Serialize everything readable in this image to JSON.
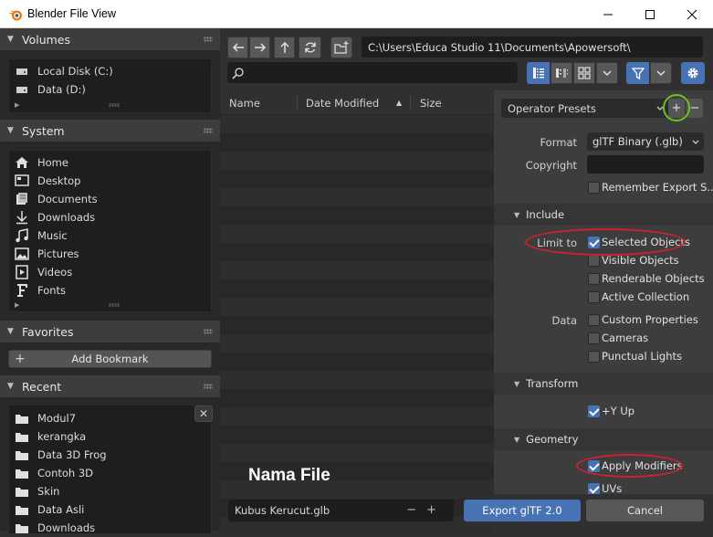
{
  "window": {
    "title": "Blender File View"
  },
  "sidebar": {
    "volumes": {
      "title": "Volumes",
      "items": [
        {
          "label": "Local Disk (C:)"
        },
        {
          "label": "Data (D:)"
        }
      ]
    },
    "system": {
      "title": "System",
      "items": [
        {
          "label": "Home",
          "icon": "home-icon"
        },
        {
          "label": "Desktop",
          "icon": "desktop-icon"
        },
        {
          "label": "Documents",
          "icon": "documents-icon"
        },
        {
          "label": "Downloads",
          "icon": "downloads-icon"
        },
        {
          "label": "Music",
          "icon": "music-icon"
        },
        {
          "label": "Pictures",
          "icon": "pictures-icon"
        },
        {
          "label": "Videos",
          "icon": "videos-icon"
        },
        {
          "label": "Fonts",
          "icon": "fonts-icon"
        }
      ]
    },
    "favorites": {
      "title": "Favorites",
      "add_bookmark": "Add Bookmark"
    },
    "recent": {
      "title": "Recent",
      "items": [
        {
          "label": "Modul7"
        },
        {
          "label": "kerangka"
        },
        {
          "label": "Data 3D Frog"
        },
        {
          "label": "Contoh 3D"
        },
        {
          "label": "Skin"
        },
        {
          "label": "Data Asli"
        },
        {
          "label": "Downloads"
        }
      ]
    }
  },
  "toolbar": {
    "path": "C:\\Users\\Educa Studio 11\\Documents\\Apowersoft\\",
    "search_value": ""
  },
  "filelist": {
    "col_name": "Name",
    "col_date": "Date Modified",
    "col_size": "Size",
    "sort_indicator": "▲"
  },
  "annotation": {
    "label": "Nama File"
  },
  "bottom": {
    "filename": "Kubus Kerucut.glb",
    "export_label": "Export glTF 2.0",
    "cancel_label": "Cancel"
  },
  "settings": {
    "operator_presets": "Operator Presets",
    "format_label": "Format",
    "format_value": "glTF Binary (.glb)",
    "copyright_label": "Copyright",
    "copyright_value": "",
    "remember_export": "Remember Export S...",
    "include": {
      "title": "Include",
      "limit_to_label": "Limit to",
      "data_label": "Data",
      "options": [
        {
          "label": "Selected Objects",
          "checked": true
        },
        {
          "label": "Visible Objects",
          "checked": false
        },
        {
          "label": "Renderable Objects",
          "checked": false
        },
        {
          "label": "Active Collection",
          "checked": false
        },
        {
          "label": "Custom Properties",
          "checked": false
        },
        {
          "label": "Cameras",
          "checked": false
        },
        {
          "label": "Punctual Lights",
          "checked": false
        }
      ]
    },
    "transform": {
      "title": "Transform",
      "y_up": "+Y Up"
    },
    "geometry": {
      "title": "Geometry",
      "apply_modifiers": "Apply Modifiers",
      "uvs": "UVs"
    }
  },
  "colors": {
    "accent_blue": "#4772b3",
    "highlight_red": "#d02030",
    "highlight_green": "#6ec01e"
  }
}
